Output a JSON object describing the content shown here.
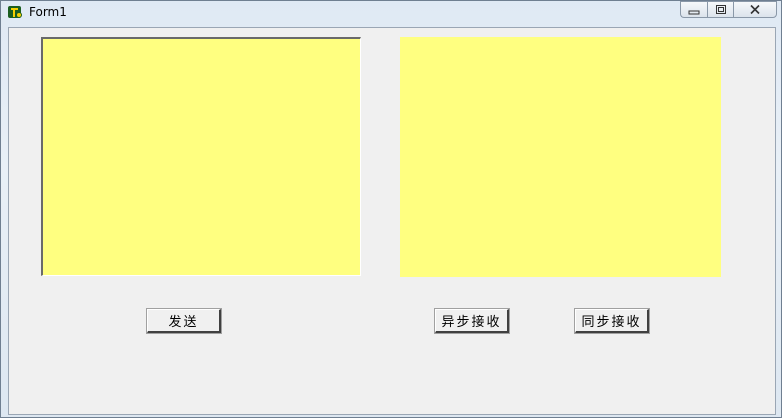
{
  "window": {
    "title": "Form1"
  },
  "caption_buttons": {
    "minimize_icon": "minimize-icon",
    "restore_icon": "restore-icon",
    "close_icon": "close-icon"
  },
  "form": {
    "send_label": "发送",
    "async_receive_label": "异步接收",
    "sync_receive_label": "同步接收",
    "textbox_color": "#ffff80"
  }
}
